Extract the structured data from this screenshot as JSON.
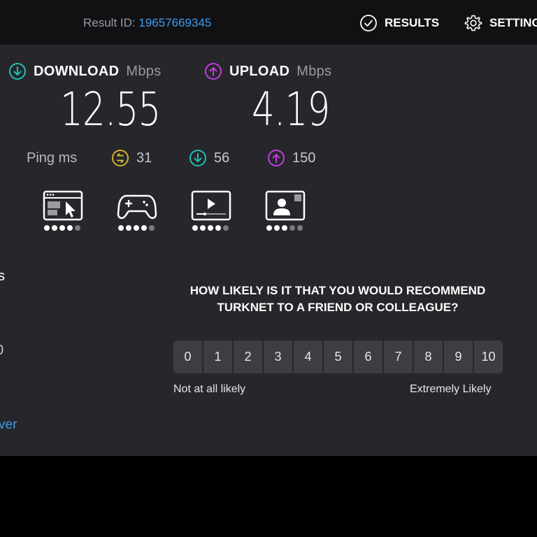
{
  "header": {
    "result_id_label": "Result ID:",
    "result_id_value": "19657669345",
    "results_label": "RESULTS",
    "settings_label": "SETTING"
  },
  "metrics": {
    "download": {
      "label": "DOWNLOAD",
      "unit": "Mbps",
      "value": "12.55",
      "icon": "download-arrow-icon",
      "color": "#1fc0b5"
    },
    "upload": {
      "label": "UPLOAD",
      "unit": "Mbps",
      "value": "4.19",
      "icon": "upload-arrow-icon",
      "color": "#c13de0"
    }
  },
  "ping": {
    "label": "Ping ms",
    "unloaded": {
      "value": "31",
      "icon": "ping-icon",
      "color": "#d4b227"
    },
    "download": {
      "value": "56",
      "icon": "download-arrow-icon",
      "color": "#1fc0b5"
    },
    "upload": {
      "value": "150",
      "icon": "upload-arrow-icon",
      "color": "#c13de0"
    }
  },
  "quality": [
    {
      "name": "browsing",
      "icon": "web-browsing-icon",
      "rating": 4,
      "max": 5
    },
    {
      "name": "gaming",
      "icon": "gamepad-icon",
      "rating": 4,
      "max": 5
    },
    {
      "name": "streaming",
      "icon": "video-play-icon",
      "rating": 4,
      "max": 5
    },
    {
      "name": "video-chat",
      "icon": "video-chat-icon",
      "rating": 3,
      "max": 5
    }
  ],
  "left_fragments": {
    "s": "s",
    "zero": "0",
    "link": "ver"
  },
  "survey": {
    "question": "HOW LIKELY IS IT THAT YOU WOULD RECOMMEND TURKNET TO A FRIEND OR COLLEAGUE?",
    "scale": [
      "0",
      "1",
      "2",
      "3",
      "4",
      "5",
      "6",
      "7",
      "8",
      "9",
      "10"
    ],
    "low_label": "Not at all likely",
    "high_label": "Extremely Likely"
  },
  "colors": {
    "accent_blue": "#3d9be9",
    "panel_bg": "#26262b",
    "topbar_bg": "#111114"
  }
}
